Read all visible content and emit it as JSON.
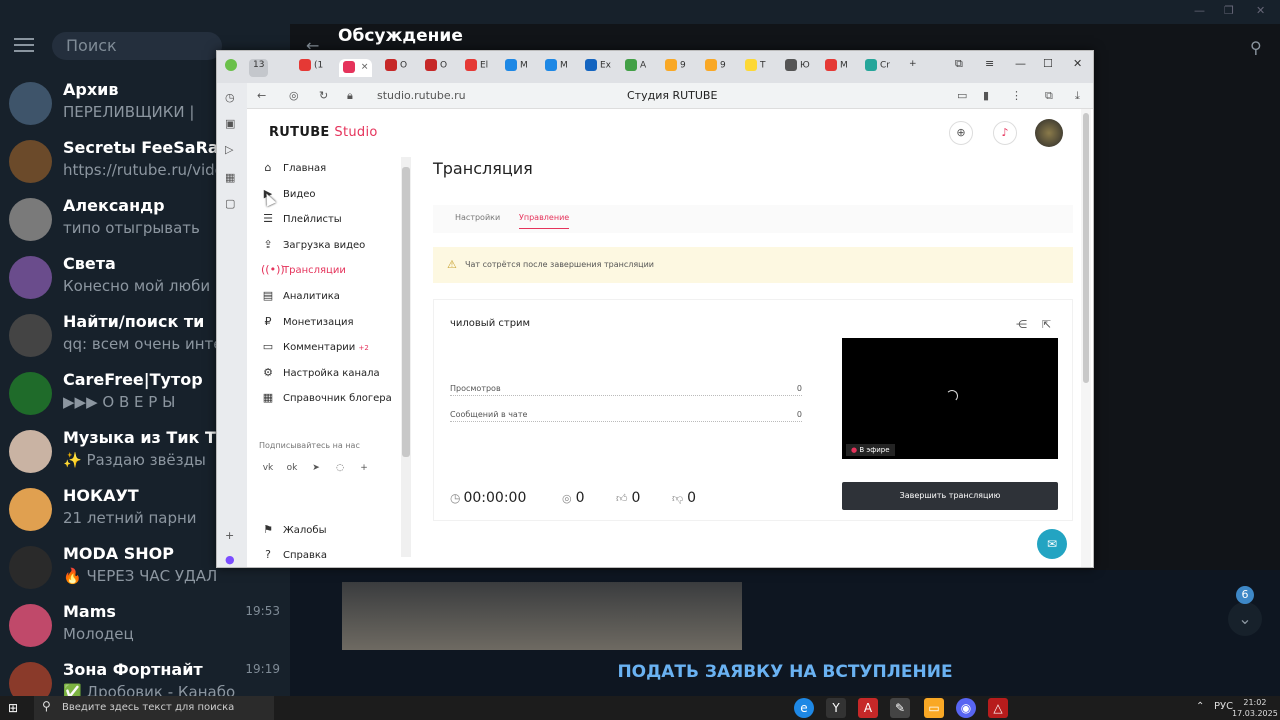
{
  "telegram": {
    "search_placeholder": "Поиск",
    "discussion_title": "Обсуждение",
    "join_button": "ПОДАТЬ ЗАЯВКУ НА ВСТУПЛЕНИЕ",
    "unread_badge": "6",
    "chats": [
      {
        "name": "Архив",
        "message": "ПЕРЕЛИВЩИКИ |",
        "time": "",
        "avatar_color": "#3e546a"
      },
      {
        "name": "Secretы FeeSaRa86",
        "message": "https://rutube.ru/video...",
        "time": "",
        "avatar_color": "#6b4a2a"
      },
      {
        "name": "Александр",
        "message": "типо отыгрывать",
        "time": "",
        "avatar_color": "#7a7a7a"
      },
      {
        "name": "Света",
        "message": "Конесно мой люби",
        "time": "",
        "avatar_color": "#6a4c8c"
      },
      {
        "name": "Найти/поиск ти",
        "message": "qq: всем очень инте",
        "time": "",
        "avatar_color": "#444444"
      },
      {
        "name": "CareFree|Тутор",
        "message": "▶▶▶ О В Е Р Ы",
        "time": "",
        "avatar_color": "#1f6b2a"
      },
      {
        "name": "Музыка из Тик Т",
        "message": "✨ Раздаю звёзды",
        "time": "",
        "avatar_color": "#c9b3a3"
      },
      {
        "name": "НОКАУТ",
        "message": "21 летний парни",
        "time": "",
        "avatar_color": "#e0a050"
      },
      {
        "name": "MODA SHOP",
        "message": "🔥 ЧЕРЕЗ ЧАС УДАЛ",
        "time": "",
        "avatar_color": "#2a2a2a"
      },
      {
        "name": "Mams",
        "message": "Молодец",
        "time": "19:53",
        "avatar_color": "#c0496a"
      },
      {
        "name": "Зона Фортнайт",
        "message": "✅ Дробовик - Канабо",
        "time": "19:19",
        "avatar_color": "#8a3a2a"
      }
    ]
  },
  "browser": {
    "url": "studio.rutube.ru",
    "page_title": "Студия RUTUBE",
    "tab_count": "13",
    "tabs": [
      {
        "label": "(1",
        "color": "#e53935"
      },
      {
        "label": "",
        "color": "#e5335b"
      },
      {
        "label": "O",
        "color": "#c62828"
      },
      {
        "label": "O",
        "color": "#c62828"
      },
      {
        "label": "El",
        "color": "#e53935"
      },
      {
        "label": "M",
        "color": "#1e88e5"
      },
      {
        "label": "M",
        "color": "#1e88e5"
      },
      {
        "label": "Ex",
        "color": "#1565c0"
      },
      {
        "label": "A",
        "color": "#43a047"
      },
      {
        "label": "9",
        "color": "#f9a825"
      },
      {
        "label": "9",
        "color": "#f9a825"
      },
      {
        "label": "T",
        "color": "#fdd835"
      },
      {
        "label": "Ю",
        "color": "#555555"
      },
      {
        "label": "M",
        "color": "#e53935"
      },
      {
        "label": "Cr",
        "color": "#26a69a"
      }
    ]
  },
  "studio": {
    "logo_main": "RUTUBE",
    "logo_sub": "Studio",
    "menu": [
      {
        "label": "Главная",
        "icon": "⌂",
        "active": false,
        "name": "home"
      },
      {
        "label": "Видео",
        "icon": "▶",
        "active": false,
        "name": "video"
      },
      {
        "label": "Плейлисты",
        "icon": "☰",
        "active": false,
        "name": "playlists"
      },
      {
        "label": "Загрузка видео",
        "icon": "⇪",
        "active": false,
        "name": "upload"
      },
      {
        "label": "Трансляции",
        "icon": "((•))",
        "active": true,
        "name": "streams"
      },
      {
        "label": "Аналитика",
        "icon": "▤",
        "active": false,
        "name": "analytics"
      },
      {
        "label": "Монетизация",
        "icon": "₽",
        "active": false,
        "name": "monetization"
      },
      {
        "label": "Комментарии",
        "icon": "▭",
        "active": false,
        "name": "comments",
        "badge": "+2"
      },
      {
        "label": "Настройка канала",
        "icon": "⚙",
        "active": false,
        "name": "channel-settings"
      },
      {
        "label": "Справочник блогера",
        "icon": "▦",
        "active": false,
        "name": "blogger-guide"
      }
    ],
    "follow_label": "Подписывайтесь на нас",
    "bottom_menu": [
      {
        "label": "Жалобы",
        "icon": "⚑",
        "name": "complaints"
      },
      {
        "label": "Справка",
        "icon": "?",
        "name": "help"
      }
    ],
    "heading": "Трансляция",
    "subtabs": [
      "Настройки",
      "Управление"
    ],
    "alert": "Чат сотрётся после завершения трансляции",
    "stream_name": "чиловый стрим",
    "stats": [
      {
        "label": "Просмотров",
        "value": "0"
      },
      {
        "label": "Сообщений в чате",
        "value": "0"
      }
    ],
    "live_label": "В эфире",
    "timer": "00:00:00",
    "viewers": "0",
    "likes": "0",
    "dislikes": "0",
    "end_button": "Завершить трансляцию"
  },
  "taskbar": {
    "search_placeholder": "Введите здесь текст для поиска",
    "lang": "РУС",
    "time": "21:02",
    "date": "17.03.2025"
  }
}
